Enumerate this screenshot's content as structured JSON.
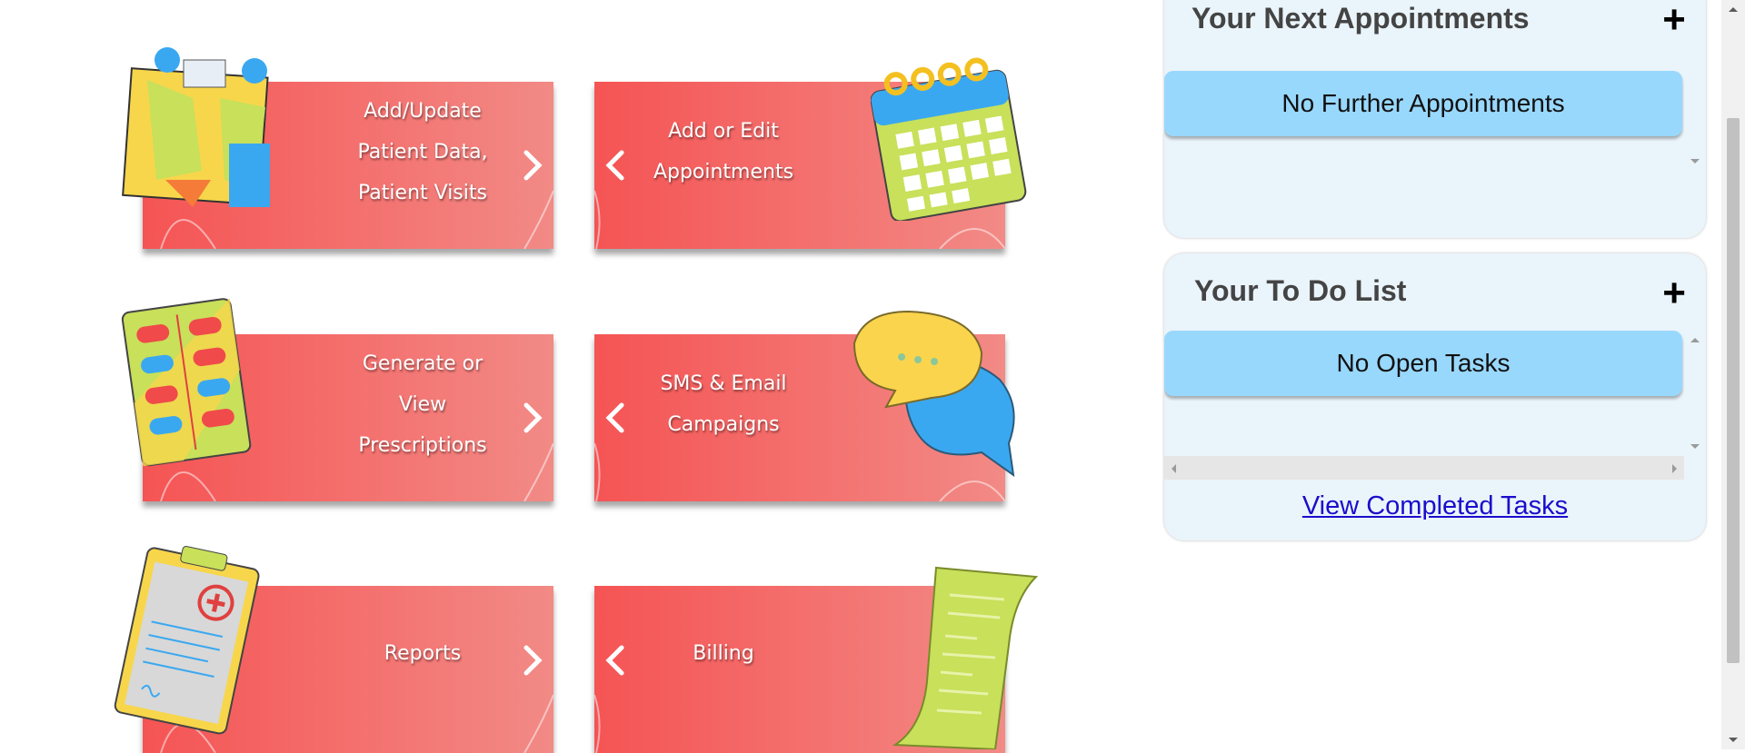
{
  "tiles": {
    "patient": {
      "label": "Add/Update\nPatient Data,\nPatient Visits"
    },
    "appointments": {
      "label": "Add or Edit\nAppointments"
    },
    "prescriptions": {
      "label": "Generate or\nView\nPrescriptions"
    },
    "campaigns": {
      "label": "SMS & Email\nCampaigns"
    },
    "reports": {
      "label": "Reports"
    },
    "billing": {
      "label": "Billing"
    }
  },
  "appointments_panel": {
    "title": "Your Next Appointments",
    "add_symbol": "+",
    "empty_text": "No Further Appointments"
  },
  "todo_panel": {
    "title": "Your To Do List",
    "add_symbol": "+",
    "empty_text": "No Open Tasks",
    "completed_link": "View Completed Tasks"
  },
  "colors": {
    "tile_start": "#f55454",
    "tile_end": "#f28a86",
    "panel_bg": "#eaf4fb",
    "pill_bg": "#99d8fd",
    "link": "#1a0dcc"
  },
  "icons": [
    "chevron-right-icon",
    "chevron-left-icon",
    "plus-icon",
    "doctor-patient-illustration",
    "calendar-illustration",
    "pill-pack-illustration",
    "chat-bubbles-illustration",
    "clipboard-illustration",
    "receipt-illustration"
  ]
}
